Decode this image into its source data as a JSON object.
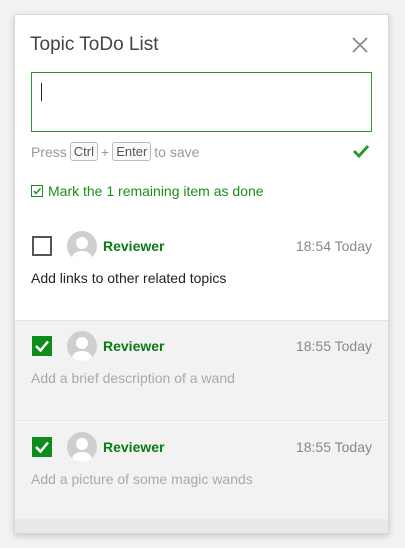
{
  "panel": {
    "title": "Topic ToDo List",
    "hint_press": "Press",
    "key_ctrl": "Ctrl",
    "plus": "+",
    "key_enter": "Enter",
    "hint_to_save": "to save",
    "mark_all_label": "Mark the 1 remaining item as done"
  },
  "colors": {
    "accent_green": "#0c8c1d",
    "muted_text": "#999999"
  },
  "items": [
    {
      "checked": false,
      "author": "Reviewer",
      "time": "18:54 Today",
      "text": "Add links to other related topics"
    },
    {
      "checked": true,
      "author": "Reviewer",
      "time": "18:55 Today",
      "text": "Add a brief description of a wand"
    },
    {
      "checked": true,
      "author": "Reviewer",
      "time": "18:55 Today",
      "text": "Add a picture of some magic wands"
    }
  ]
}
